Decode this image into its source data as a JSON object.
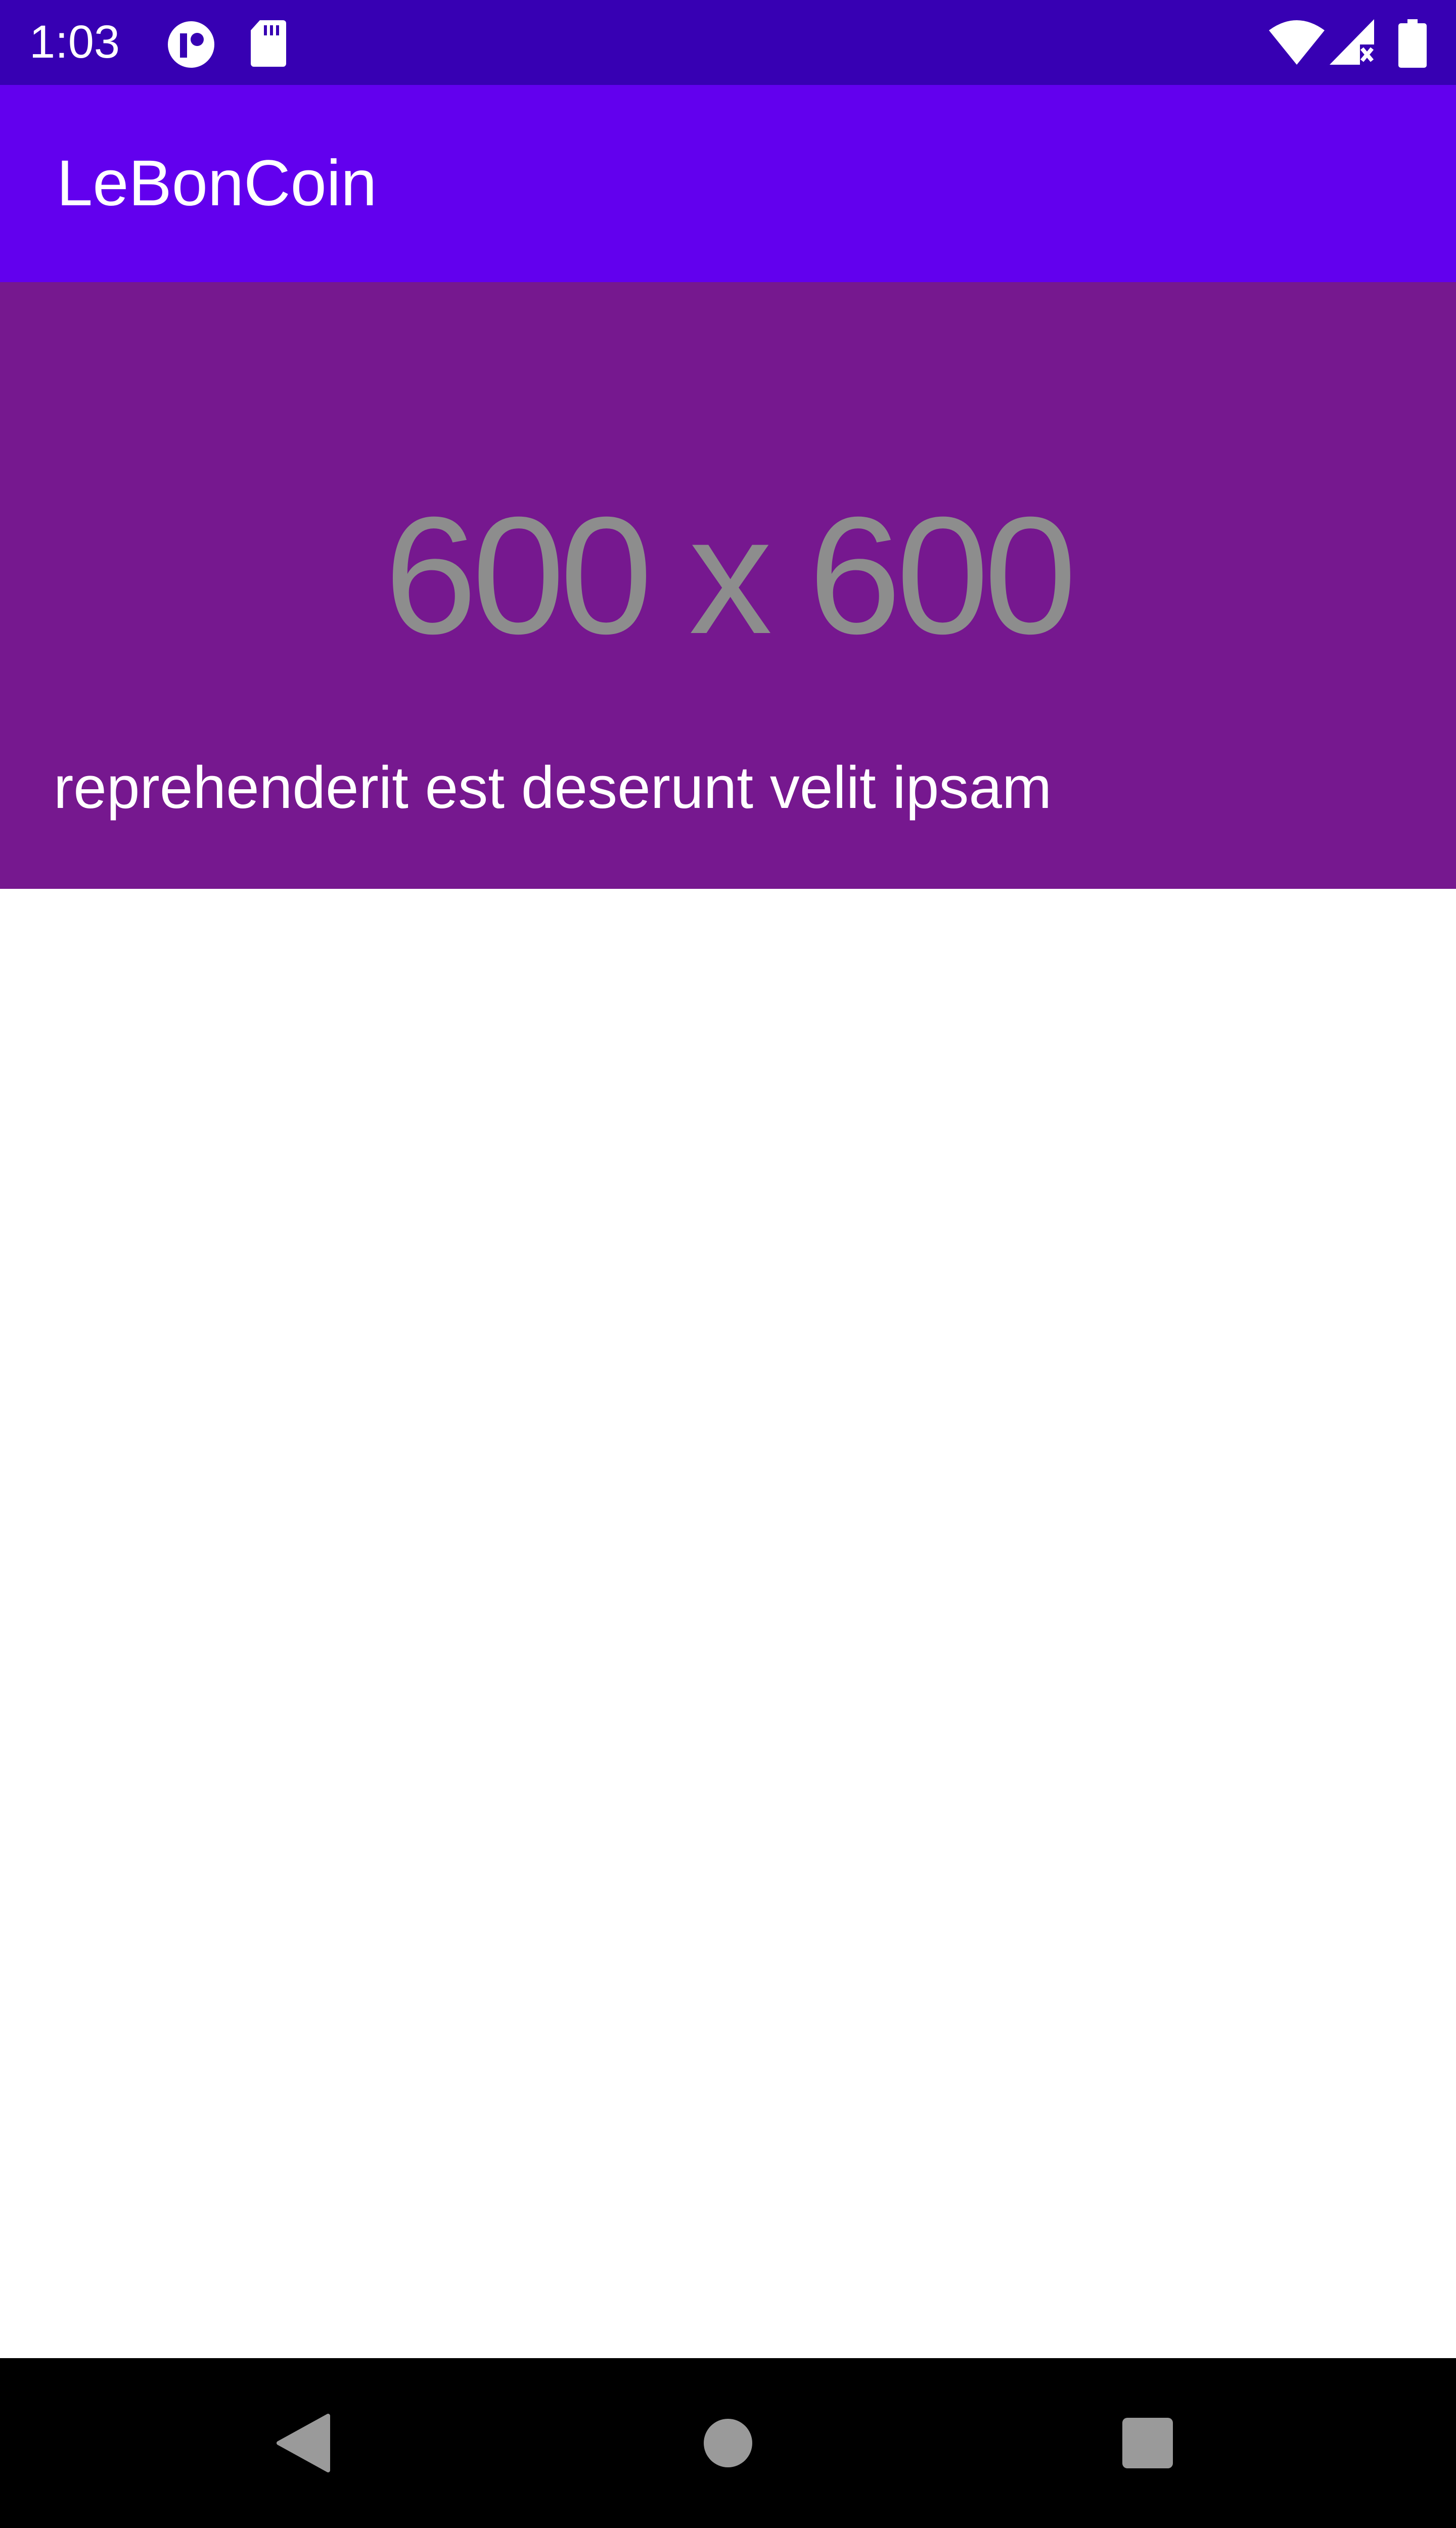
{
  "status_bar": {
    "time": "1:03",
    "icons": [
      "app-notification-icon",
      "sd-card-icon",
      "wifi-icon",
      "cell-signal-no-data-icon",
      "battery-icon"
    ]
  },
  "app_bar": {
    "title": "LeBonCoin"
  },
  "list": {
    "items": [
      {
        "image_placeholder_text": "600 x 600",
        "title": "reprehenderit est deserunt velit ipsam"
      }
    ]
  },
  "nav_bar": {
    "icons": [
      "back-icon",
      "home-icon",
      "recents-icon"
    ]
  },
  "colors": {
    "status_bar": "#3700B3",
    "app_bar": "#6200EE",
    "card": "#76188F",
    "nav_bar": "#000000"
  }
}
